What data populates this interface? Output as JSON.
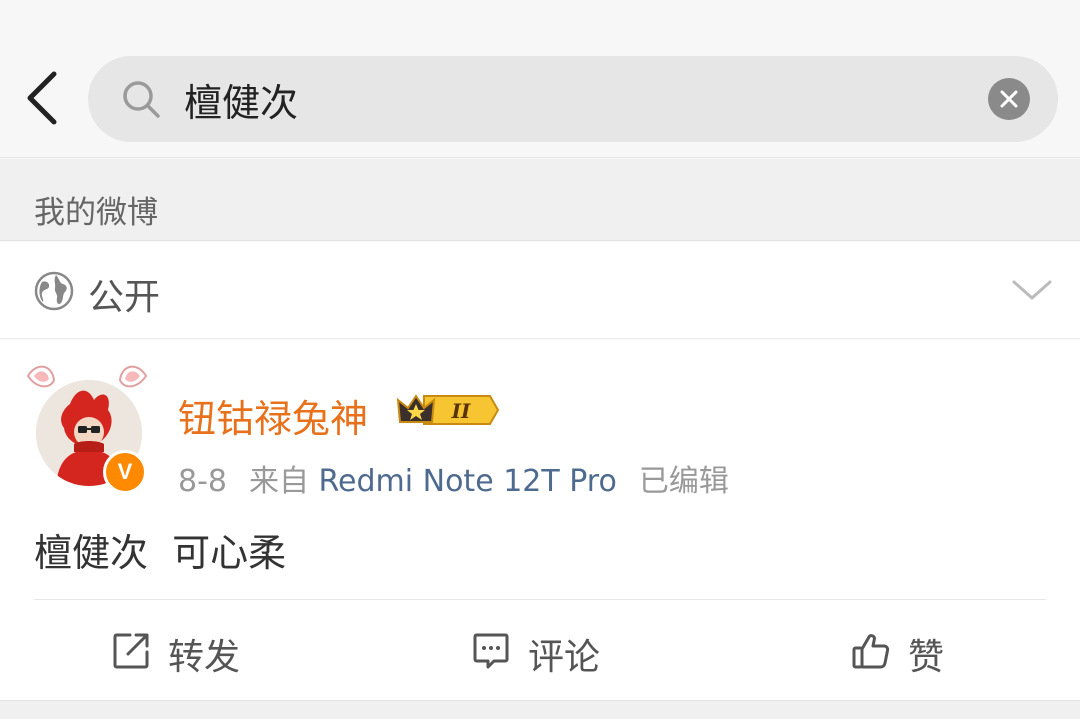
{
  "search": {
    "query": "檀健次"
  },
  "section": {
    "title": "我的微博"
  },
  "visibility": {
    "label": "公开"
  },
  "post": {
    "username": "钮钴禄兔神",
    "vip_level": "II",
    "date": "8-8",
    "from_label": "来自",
    "source_app": "Redmi Note 12T Pro",
    "edited_label": "已编辑",
    "verified_badge": "V",
    "text": "檀健次  可心柔",
    "actions": {
      "repost": "转发",
      "comment": "评论",
      "like": "赞"
    }
  },
  "colors": {
    "username": "#e8711c",
    "source_app": "#4f6a8f",
    "badge": "#ff8a00",
    "search_bg": "#e6e6e6"
  },
  "icons": {
    "back": "chevron-left-icon",
    "search": "search-icon",
    "clear": "close-circle-icon",
    "visibility": "globe-icon",
    "expand": "chevron-down-icon",
    "repost": "share-icon",
    "comment": "comment-icon",
    "like": "thumbs-up-icon"
  }
}
